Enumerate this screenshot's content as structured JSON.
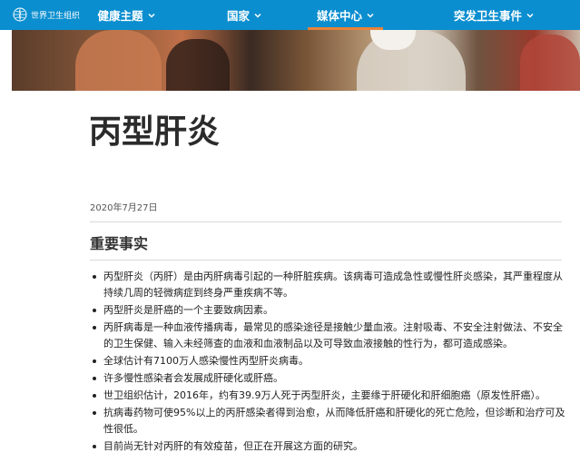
{
  "header": {
    "logo_text": "世界卫生组织",
    "nav": [
      {
        "label": "健康主题",
        "active": false
      },
      {
        "label": "国家",
        "active": false
      },
      {
        "label": "媒体中心",
        "active": true
      },
      {
        "label": "突发卫生事件",
        "active": false
      }
    ]
  },
  "article": {
    "title": "丙型肝炎",
    "date": "2020年7月27日",
    "section_heading": "重要事实",
    "facts": [
      "丙型肝炎（丙肝）是由丙肝病毒引起的一种肝脏疾病。该病毒可造成急性或慢性肝炎感染，其严重程度从持续几周的轻微病症到终身严重疾病不等。",
      "丙型肝炎是肝癌的一个主要致病因素。",
      "丙肝病毒是一种血液传播病毒，最常见的感染途径是接触少量血液。注射吸毒、不安全注射做法、不安全的卫生保健、输入未经筛查的血液和血液制品以及可导致血液接触的性行为，都可造成感染。",
      "全球估计有7100万人感染慢性丙型肝炎病毒。",
      "许多慢性感染者会发展成肝硬化或肝癌。",
      "世卫组织估计，2016年，约有39.9万人死于丙型肝炎，主要缘于肝硬化和肝细胞癌（原发性肝癌）。",
      "抗病毒药物可使95%以上的丙肝感染者得到治愈，从而降低肝癌和肝硬化的死亡危险，但诊断和治疗可及性很低。",
      "目前尚无针对丙肝的有效疫苗，但正在开展这方面的研究。"
    ]
  },
  "colors": {
    "nav_bg": "#0a8ecf",
    "active_underline": "#e8833a"
  },
  "icons": [
    "who-emblem-icon",
    "chevron-down-icon"
  ]
}
